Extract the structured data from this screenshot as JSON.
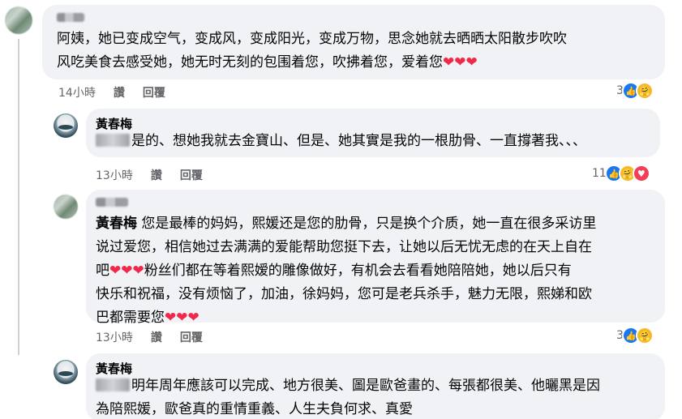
{
  "comments": [
    {
      "text_line1": "阿姨，她已变成空气，变成风，变成阳光，变成万物，思念她就去晒晒太阳散步吹吹",
      "text_line2": "风吃美食去感受她，她无时无刻的包围着您，吹拂着您，爱着您",
      "hearts": "❤❤❤",
      "time": "14小時",
      "like_label": "讚",
      "reply_label": "回覆",
      "reaction_count": "3"
    },
    {
      "author": "黃春梅",
      "text": "是的、想她我就去金寶山、但是、她其實是我的一根肋骨、一直撐著我、、、",
      "time": "13小時",
      "like_label": "讚",
      "reply_label": "回覆",
      "reaction_count": "11"
    },
    {
      "mention": "黃春梅",
      "text_line1": " 您是最棒的妈妈，熙媛还是您的肋骨，只是换个介质，她一直在很多采访里",
      "text_line2": "说过爱您，相信她过去满满的爱能帮助您挺下去，让她以后无忧无虑的在天上自在",
      "text_line3a": "吧",
      "hearts_a": "❤❤❤",
      "text_line3b": "粉丝们都在等着熙嫒的雕像做好，有机会去看看她陪陪她，她以后只有",
      "text_line4": "快乐和祝福，没有烦恼了，加油，徐妈妈，您可是老兵杀手，魅力无限，熙娣和欧",
      "text_line5": "巴都需要您",
      "hearts_b": "❤❤❤",
      "time": "13小時",
      "like_label": "讚",
      "reply_label": "回覆",
      "reaction_count": "3"
    },
    {
      "author": "黃春梅",
      "text_line1": "明年周年應該可以完成、地方很美、圖是歐爸畫的、每張都很美、他曬黑是因",
      "text_line2": "為陪熙媛，歐爸真的重情重義、人生夫負何求、真愛"
    }
  ],
  "colors": {
    "bubble": "#f0f2f5",
    "meta_text": "#65676b",
    "like_blue": "#1877f2",
    "heart_red": "#f02849"
  }
}
